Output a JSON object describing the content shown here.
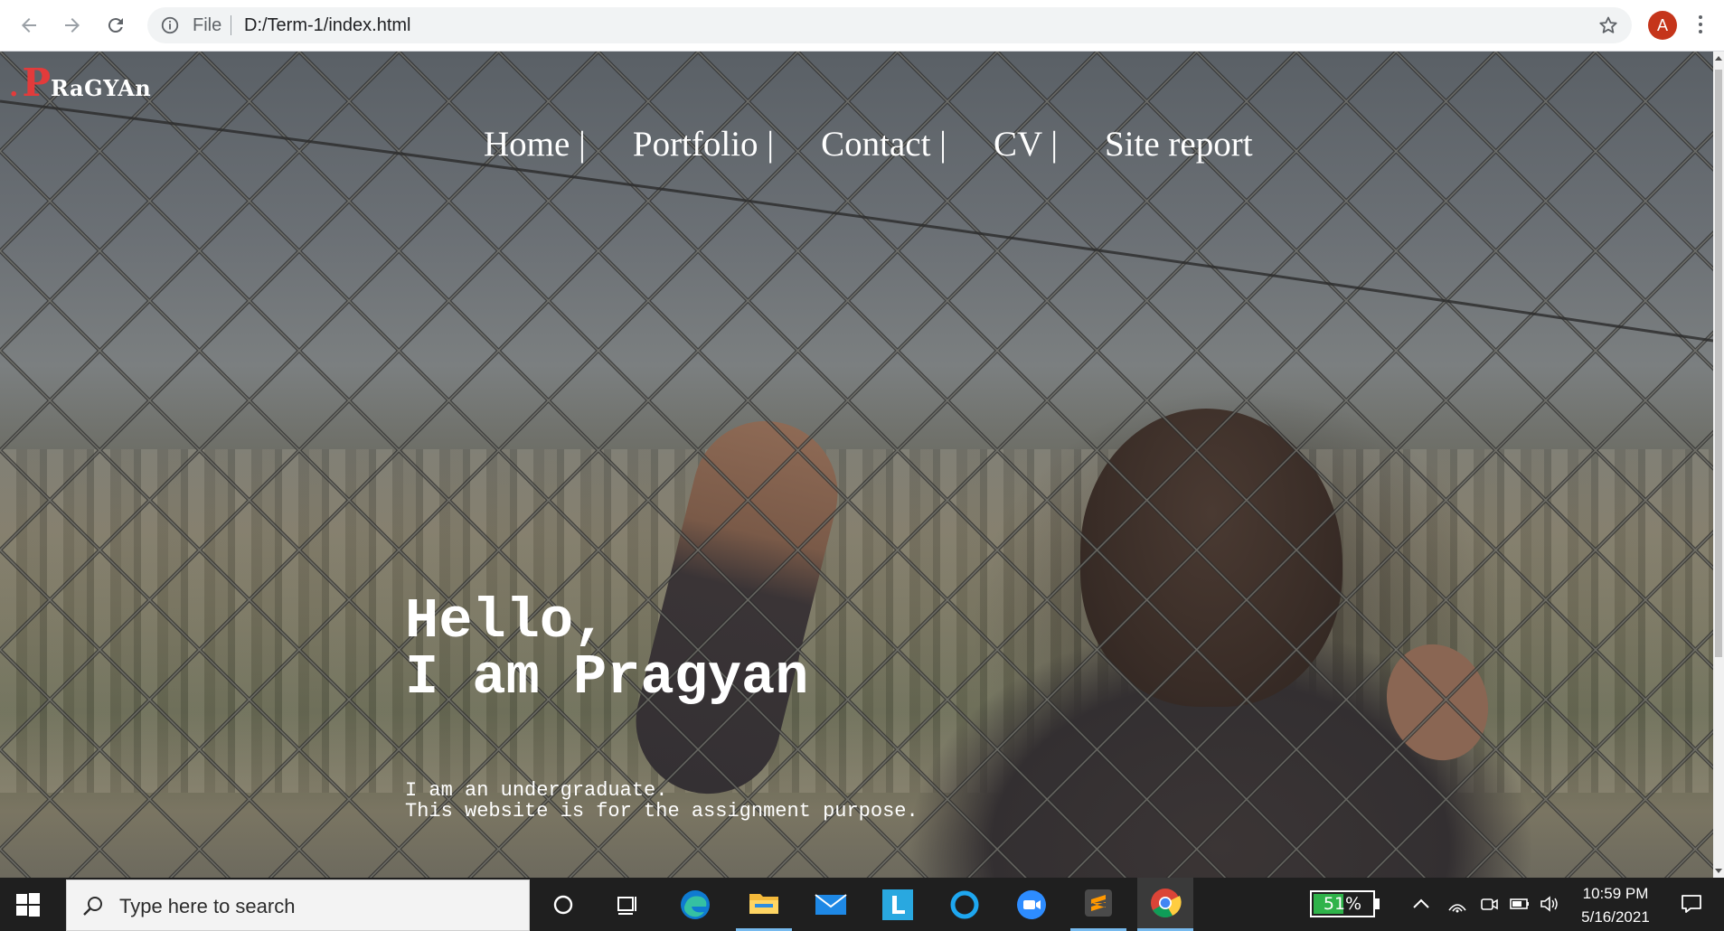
{
  "browser": {
    "url_scheme_label": "File",
    "url": "D:/Term-1/index.html",
    "profile_initial": "A",
    "colors": {
      "profile_avatar": "#c5351b"
    }
  },
  "site": {
    "logo": {
      "dot": ".",
      "first_letter": "P",
      "rest": "RaGYAn"
    },
    "nav": [
      {
        "label": "Home |"
      },
      {
        "label": "Portfolio |"
      },
      {
        "label": "Contact |"
      },
      {
        "label": "CV |"
      },
      {
        "label": "Site report"
      }
    ],
    "hero": {
      "line1": "Hello,",
      "line2": "I am Pragyan",
      "sub1": "I am an undergraduate.",
      "sub2": "This website is for the assignment purpose."
    },
    "colors": {
      "logo_accent": "#e23b3b",
      "text": "#ffffff"
    }
  },
  "taskbar": {
    "search_placeholder": "Type here to search",
    "apps": [
      "cortana-icon",
      "task-view-icon",
      "edge-icon",
      "file-explorer-icon",
      "mail-icon",
      "l-app-icon",
      "circle-app-icon",
      "zoom-icon",
      "sublime-text-icon",
      "chrome-icon"
    ],
    "battery_percent_label": "51%",
    "battery_level": 0.51,
    "time": "10:59 PM",
    "date": "5/16/2021"
  }
}
